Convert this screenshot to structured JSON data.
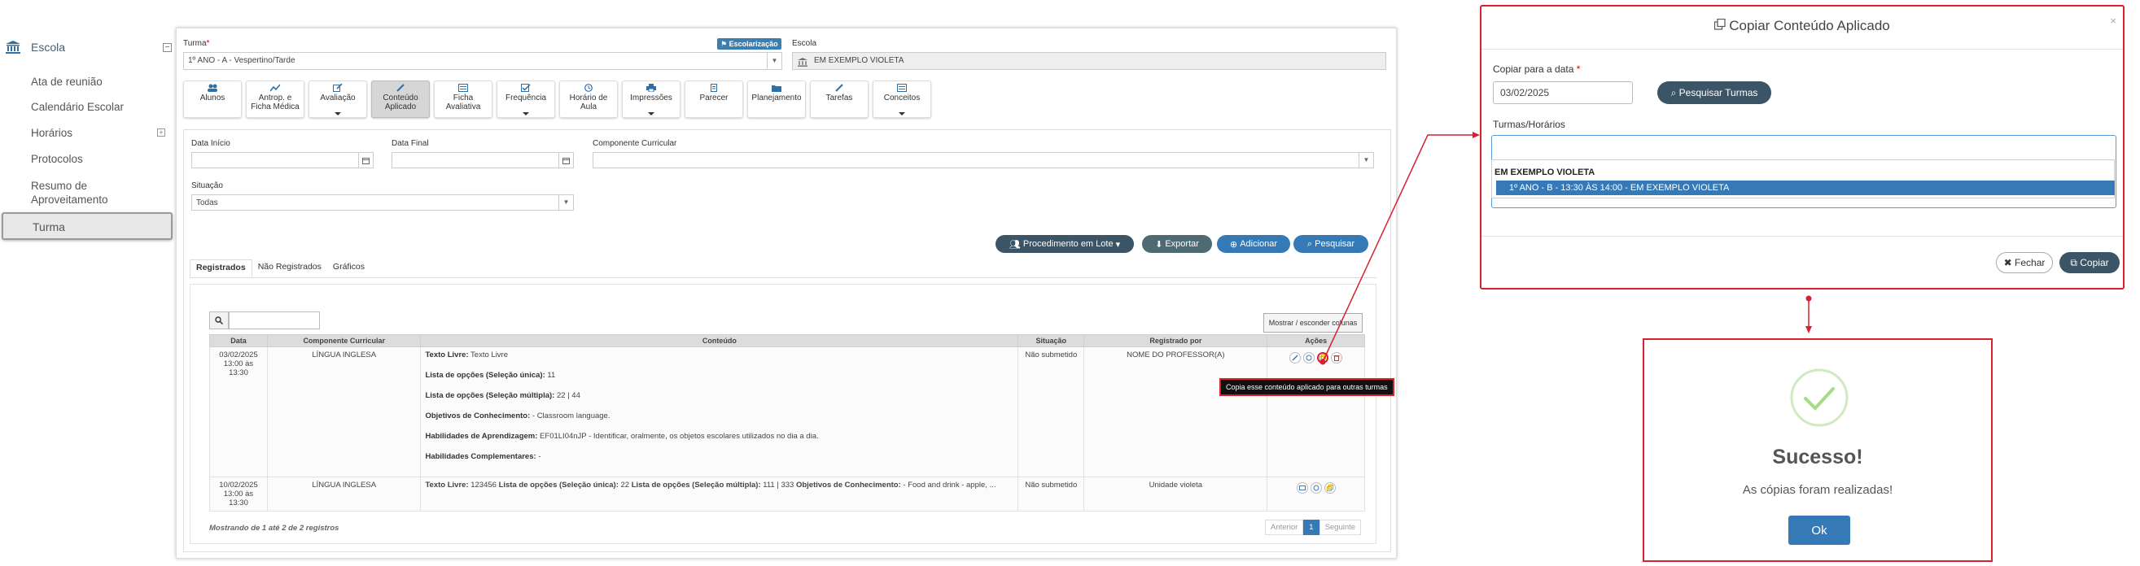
{
  "sidebar": {
    "title": "Escola",
    "items": [
      "Ata de reunião",
      "Calendário Escolar",
      "Horários",
      "Protocolos",
      "Resumo de",
      "Aproveitamento"
    ],
    "active": "Turma"
  },
  "form": {
    "turma_label": "Turma",
    "req_mark": "*",
    "turma_value": "1º ANO - A - Vespertino/Tarde",
    "escolarizacao_badge": "Escolarização",
    "escola_label": "Escola",
    "escola_value": "EM EXEMPLO VIOLETA"
  },
  "tabs": [
    {
      "line1": "Alunos",
      "line2": ""
    },
    {
      "line1": "Antrop. e",
      "line2": "Ficha Médica"
    },
    {
      "line1": "Avaliação",
      "line2": ""
    },
    {
      "line1": "Conteúdo",
      "line2": "Aplicado"
    },
    {
      "line1": "Ficha",
      "line2": "Avaliativa"
    },
    {
      "line1": "Frequência",
      "line2": ""
    },
    {
      "line1": "Horário de",
      "line2": "Aula"
    },
    {
      "line1": "Impressões",
      "line2": ""
    },
    {
      "line1": "Parecer",
      "line2": ""
    },
    {
      "line1": "Planejamento",
      "line2": ""
    },
    {
      "line1": "Tarefas",
      "line2": ""
    },
    {
      "line1": "Conceitos",
      "line2": ""
    }
  ],
  "filters": {
    "data_inicio": "Data Início",
    "data_final": "Data Final",
    "componente": "Componente Curricular",
    "situacao": "Situação",
    "situacao_value": "Todas"
  },
  "actions": {
    "procedimento": "Procedimento em Lote",
    "exportar": "Exportar",
    "adicionar": "Adicionar",
    "pesquisar": "Pesquisar"
  },
  "subtabs": [
    "Registrados",
    "Não Registrados",
    "Gráficos"
  ],
  "table": {
    "columns_button": "Mostrar / esconder colunas",
    "headers": [
      "Data",
      "Componente Curricular",
      "Conteúdo",
      "Situação",
      "Registrado por",
      "Ações"
    ],
    "row1": {
      "date": "03/02/2025",
      "time": "13:00 às 13:30",
      "component": "LÍNGUA INGLESA",
      "lines": [
        {
          "k": "Texto Livre:",
          "v": " Texto Livre"
        },
        {
          "k": "Lista de opções (Seleção única):",
          "v": " 11"
        },
        {
          "k": "Lista de opções (Seleção múltipla):",
          "v": " 22 | 44"
        },
        {
          "k": "Objetivos de Conhecimento:",
          "v": "  - Classroom language."
        },
        {
          "k": "Habilidades de Aprendizagem:",
          "v": " EF01LI04nJP - Identificar, oralmente, os objetos escolares utilizados no dia a dia."
        },
        {
          "k": "Habilidades Complementares:",
          "v": " -"
        }
      ],
      "status": "Não submetido",
      "by": "NOME DO PROFESSOR(A)"
    },
    "row2": {
      "date": "10/02/2025",
      "time": "13:00 às 13:30",
      "component": "LÍNGUA INGLESA",
      "k1": "Texto Livre:",
      "v1": " 123456 ",
      "k2": "Lista de opções (Seleção única):",
      "v2": " 22 ",
      "k3": "Lista de opções (Seleção múltipla):",
      "v3": " 111 | 333 ",
      "k4": "Objetivos de Conhecimento:",
      "v4": " - Food and drink - apple, ...",
      "status": "Não submetido",
      "by": "Unidade violeta"
    },
    "tooltip": "Copia esse conteúdo aplicado para outras turmas",
    "footer": "Mostrando de 1 até 2 de 2 registros",
    "pager": {
      "prev": "Anterior",
      "page": "1",
      "next": "Seguinte"
    }
  },
  "modal": {
    "title": "Copiar Conteúdo Aplicado",
    "close": "×",
    "date_label": "Copiar para a data",
    "date_value": "03/02/2025",
    "search_btn": "Pesquisar Turmas",
    "turmas_label": "Turmas/Horários",
    "group": "EM EXEMPLO VIOLETA",
    "option": "1º ANO - B - 13:30 ÀS 14:00 - EM EXEMPLO VIOLETA",
    "close_btn": "Fechar",
    "copy_btn": "Copiar"
  },
  "success": {
    "title": "Sucesso!",
    "text": "As cópias foram realizadas!",
    "ok": "Ok"
  },
  "colors": {
    "primary": "#357ab7",
    "dark": "#3b5466",
    "highlight": "#d8202e",
    "success": "#a5dc86"
  }
}
